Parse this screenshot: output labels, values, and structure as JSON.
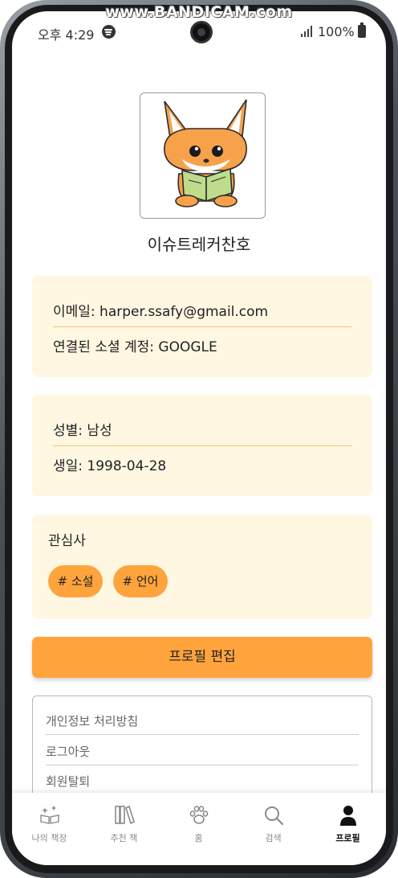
{
  "watermark": "www.BANDICAM.com",
  "status_bar": {
    "time": "오후 4:29",
    "battery": "100%",
    "icons": [
      "spotify-icon",
      "signal-icon",
      "battery-icon"
    ]
  },
  "profile": {
    "avatar": "fox-reading-book-illustration",
    "username": "이슈트레커찬호"
  },
  "account_card": {
    "email_line": "이메일: harper.ssafy@gmail.com",
    "social_line": "연결된 소셜 계정: GOOGLE"
  },
  "personal_card": {
    "gender_line": "성별: 남성",
    "birth_line": "생일: 1998-04-28"
  },
  "interests": {
    "title": "관심사",
    "tags": [
      "# 소설",
      "# 언어"
    ]
  },
  "edit_button": "프로필 편집",
  "menu": {
    "items": [
      "개인정보 처리방침",
      "로그아웃",
      "회원탈퇴"
    ]
  },
  "bottom_nav": {
    "items": [
      {
        "label": "나의 책장",
        "icon": "bookshelf-sparkle-icon",
        "active": false
      },
      {
        "label": "추천 책",
        "icon": "books-icon",
        "active": false
      },
      {
        "label": "홈",
        "icon": "paw-icon",
        "active": false
      },
      {
        "label": "검색",
        "icon": "search-icon",
        "active": false
      },
      {
        "label": "프로필",
        "icon": "person-icon",
        "active": true
      }
    ]
  },
  "colors": {
    "accent": "#ffa43c",
    "card_background": "#fff7e2",
    "divider": "#f1c86a"
  }
}
